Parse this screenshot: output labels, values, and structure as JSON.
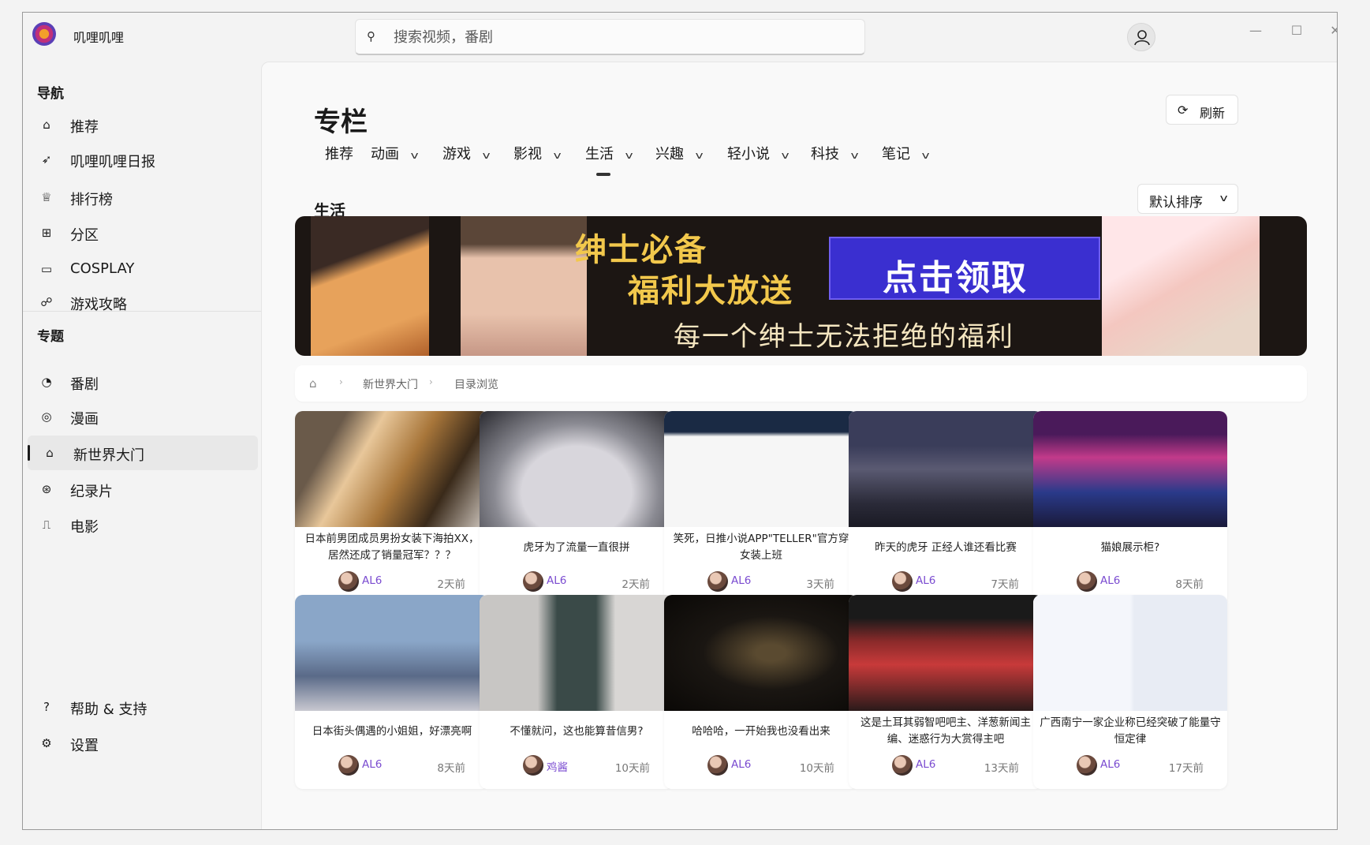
{
  "app": {
    "title": "叽哩叽哩"
  },
  "search": {
    "placeholder": "搜索视频，番剧"
  },
  "window_controls": {
    "minimize": "—",
    "maximize": "☐",
    "close": "✕"
  },
  "sidebar": {
    "nav_heading": "导航",
    "nav_items": [
      {
        "label": "推荐",
        "icon": "home-icon"
      },
      {
        "label": "叽哩叽哩日报",
        "icon": "rocket-icon"
      },
      {
        "label": "排行榜",
        "icon": "trophy-icon"
      },
      {
        "label": "分区",
        "icon": "grid-icon"
      },
      {
        "label": "COSPLAY",
        "icon": "video-icon"
      },
      {
        "label": "游戏攻略",
        "icon": "game-icon"
      }
    ],
    "topic_heading": "专题",
    "topic_items": [
      {
        "label": "番剧",
        "icon": "palette-icon"
      },
      {
        "label": "漫画",
        "icon": "spiral-icon"
      },
      {
        "label": "新世界大门",
        "icon": "door-icon",
        "active": true
      },
      {
        "label": "纪录片",
        "icon": "compass-icon"
      },
      {
        "label": "电影",
        "icon": "clapper-icon"
      }
    ],
    "footer_items": [
      {
        "label": "帮助 & 支持",
        "icon": "help-icon"
      },
      {
        "label": "设置",
        "icon": "gear-icon"
      }
    ]
  },
  "main": {
    "title": "专栏",
    "refresh_label": "刷新",
    "tabs": [
      {
        "label": "推荐",
        "has_menu": false
      },
      {
        "label": "动画",
        "has_menu": true
      },
      {
        "label": "游戏",
        "has_menu": true
      },
      {
        "label": "影视",
        "has_menu": true
      },
      {
        "label": "生活",
        "has_menu": true,
        "active": true
      },
      {
        "label": "兴趣",
        "has_menu": true
      },
      {
        "label": "轻小说",
        "has_menu": true
      },
      {
        "label": "科技",
        "has_menu": true
      },
      {
        "label": "笔记",
        "has_menu": true
      }
    ],
    "section_title": "生活",
    "sort_label": "默认排序",
    "banner": {
      "line1": "绅士必备",
      "line2": "福利大放送",
      "cta": "点击领取",
      "line3": "每一个绅士无法拒绝的福利"
    },
    "breadcrumb": [
      "新世界大门",
      "目录浏览"
    ],
    "cards": [
      {
        "title": "日本前男团成员男扮女装下海拍XX，居然还成了销量冠军？？？",
        "author": "AL6",
        "time": "2天前"
      },
      {
        "title": "虎牙为了流量一直很拼",
        "author": "AL6",
        "time": "2天前"
      },
      {
        "title": "笑死，日推小说APP\"TELLER\"官方穿女装上班",
        "author": "AL6",
        "time": "3天前"
      },
      {
        "title": "昨天的虎牙 正经人谁还看比赛",
        "author": "AL6",
        "time": "7天前"
      },
      {
        "title": "猫娘展示柜?",
        "author": "AL6",
        "time": "8天前"
      },
      {
        "title": "日本街头偶遇的小姐姐，好漂亮啊",
        "author": "AL6",
        "time": "8天前"
      },
      {
        "title": "不懂就问，这也能算昔信男?",
        "author": "鸡酱",
        "time": "10天前"
      },
      {
        "title": "哈哈哈，一开始我也没看出来",
        "author": "AL6",
        "time": "10天前"
      },
      {
        "title": "这是土耳其弱智吧吧主、洋葱新闻主编、迷惑行为大赏得主吧",
        "author": "AL6",
        "time": "13天前"
      },
      {
        "title": "广西南宁一家企业称已经突破了能量守恒定律",
        "author": "AL6",
        "time": "17天前"
      }
    ]
  }
}
